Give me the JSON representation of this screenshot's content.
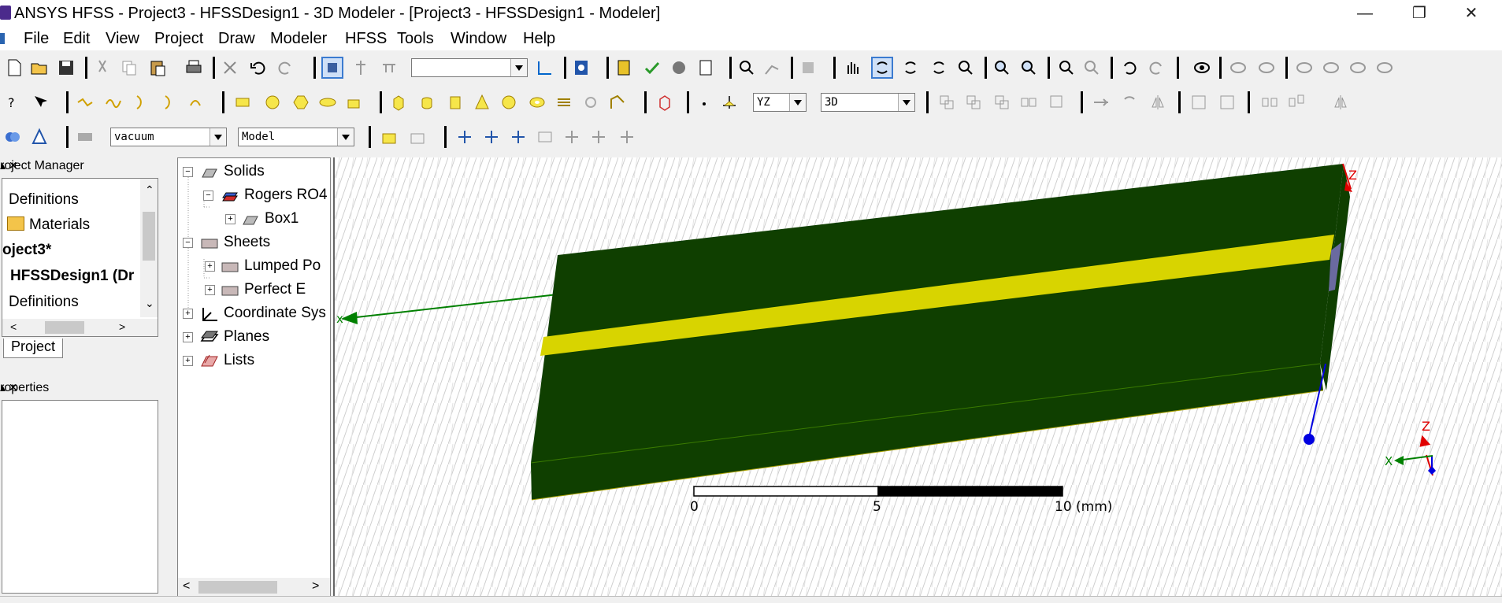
{
  "titlebar": {
    "title": "ANSYS HFSS - Project3 - HFSSDesign1 - 3D Modeler - [Project3 - HFSSDesign1 - Modeler]"
  },
  "menu": [
    "File",
    "Edit",
    "View",
    "Project",
    "Draw",
    "Modeler",
    "HFSS",
    "Tools",
    "Window",
    "Help"
  ],
  "toolbar3": {
    "material": "vacuum",
    "model": "Model"
  },
  "toolbar2": {
    "plane": "YZ",
    "view": "3D"
  },
  "project_manager": {
    "title": "roject Manager",
    "items": [
      "Definitions",
      "Materials",
      "oject3*",
      "HFSSDesign1 (Dr",
      "Definitions"
    ],
    "tab": "Project"
  },
  "properties": {
    "title": "roperties"
  },
  "tree": {
    "solids": "Solids",
    "rogers": "Rogers RO4",
    "box1": "Box1",
    "sheets": "Sheets",
    "lumped": "Lumped Po",
    "perfect": "Perfect E",
    "coord": "Coordinate Sys",
    "planes": "Planes",
    "lists": "Lists"
  },
  "viewport": {
    "axis_x": "x",
    "axis_z": "Z",
    "triad_x": "X",
    "triad_z": "Z",
    "scale": {
      "tick0": "0",
      "tick5": "5",
      "tick10": "10 (mm)"
    },
    "colors": {
      "substrate": "#0f3f00",
      "strip": "#d8d400",
      "x_axis": "#008000",
      "z_axis": "#e00000",
      "y_axis": "#0000e0"
    }
  }
}
